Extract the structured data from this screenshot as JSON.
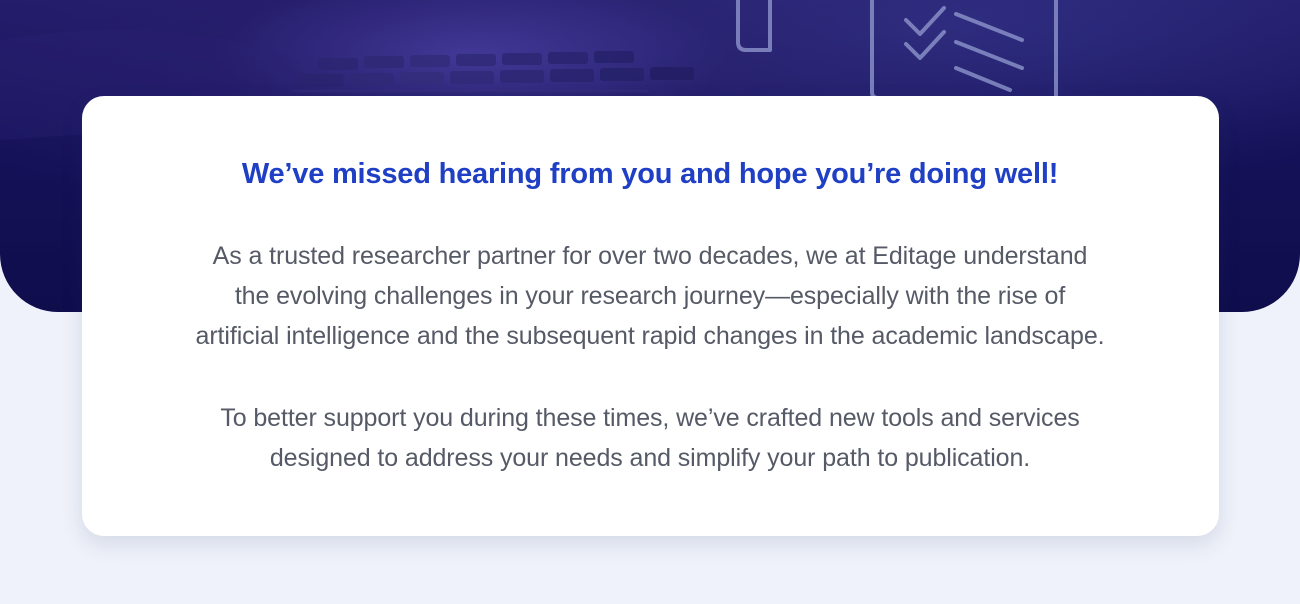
{
  "hero": {
    "image": "laptop-keyboard-checklist-background"
  },
  "card": {
    "headline": "We’ve missed hearing from you and hope you’re doing well!",
    "paragraph_1_lines": [
      "As a trusted researcher partner for over two decades, we at Editage understand",
      "the evolving challenges in your research journey—especially with the rise of",
      "artificial intelligence and the subsequent rapid changes in the academic landscape."
    ],
    "paragraph_2_lines": [
      "To better support you during these times, we’ve crafted new tools and services",
      "designed to address your needs and simplify your path to publication."
    ]
  },
  "colors": {
    "page_background": "#eff2fa",
    "hero_background": "#16125a",
    "headline": "#1f3fc4",
    "body_text": "#555a66",
    "card_background": "#ffffff"
  }
}
